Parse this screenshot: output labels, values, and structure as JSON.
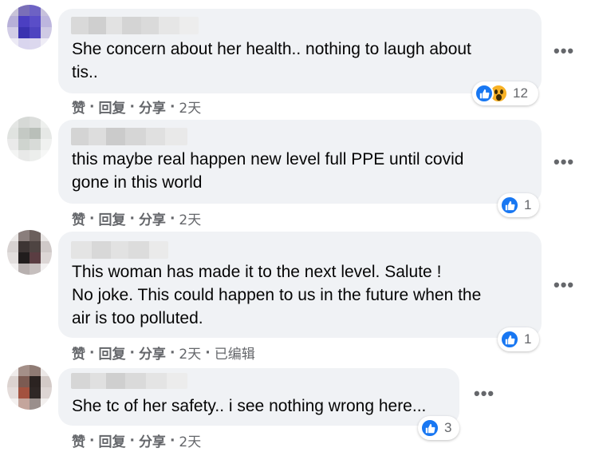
{
  "comments": [
    {
      "text": "She concern about her health.. nothing to laugh about\ntis..",
      "reaction_count": "12",
      "like": "赞",
      "reply": "回复",
      "share": "分享",
      "time": "2天",
      "edited": ""
    },
    {
      "text": "this maybe real happen new level full PPE until covid\ngone in this world",
      "reaction_count": "1",
      "like": "赞",
      "reply": "回复",
      "share": "分享",
      "time": "2天",
      "edited": ""
    },
    {
      "text": "This woman has made it to the next level. Salute !\nNo joke. This could happen to us in the future when the\nair is too polluted.",
      "reaction_count": "1",
      "like": "赞",
      "reply": "回复",
      "share": "分享",
      "time": "2天",
      "edited": "已编辑"
    },
    {
      "text": "She tc of her safety.. i see nothing wrong here...",
      "reaction_count": "3",
      "like": "赞",
      "reply": "回复",
      "share": "分享",
      "time": "2天",
      "edited": ""
    }
  ],
  "more_glyph": "•••",
  "colors": {
    "bubble": "#f0f2f5",
    "like_blue": "#1877f2",
    "meta_gray": "#65676b",
    "wow_yellow": "#f7b125"
  },
  "icons": [
    "like-reaction-icon",
    "wow-reaction-icon",
    "more-options-icon"
  ]
}
